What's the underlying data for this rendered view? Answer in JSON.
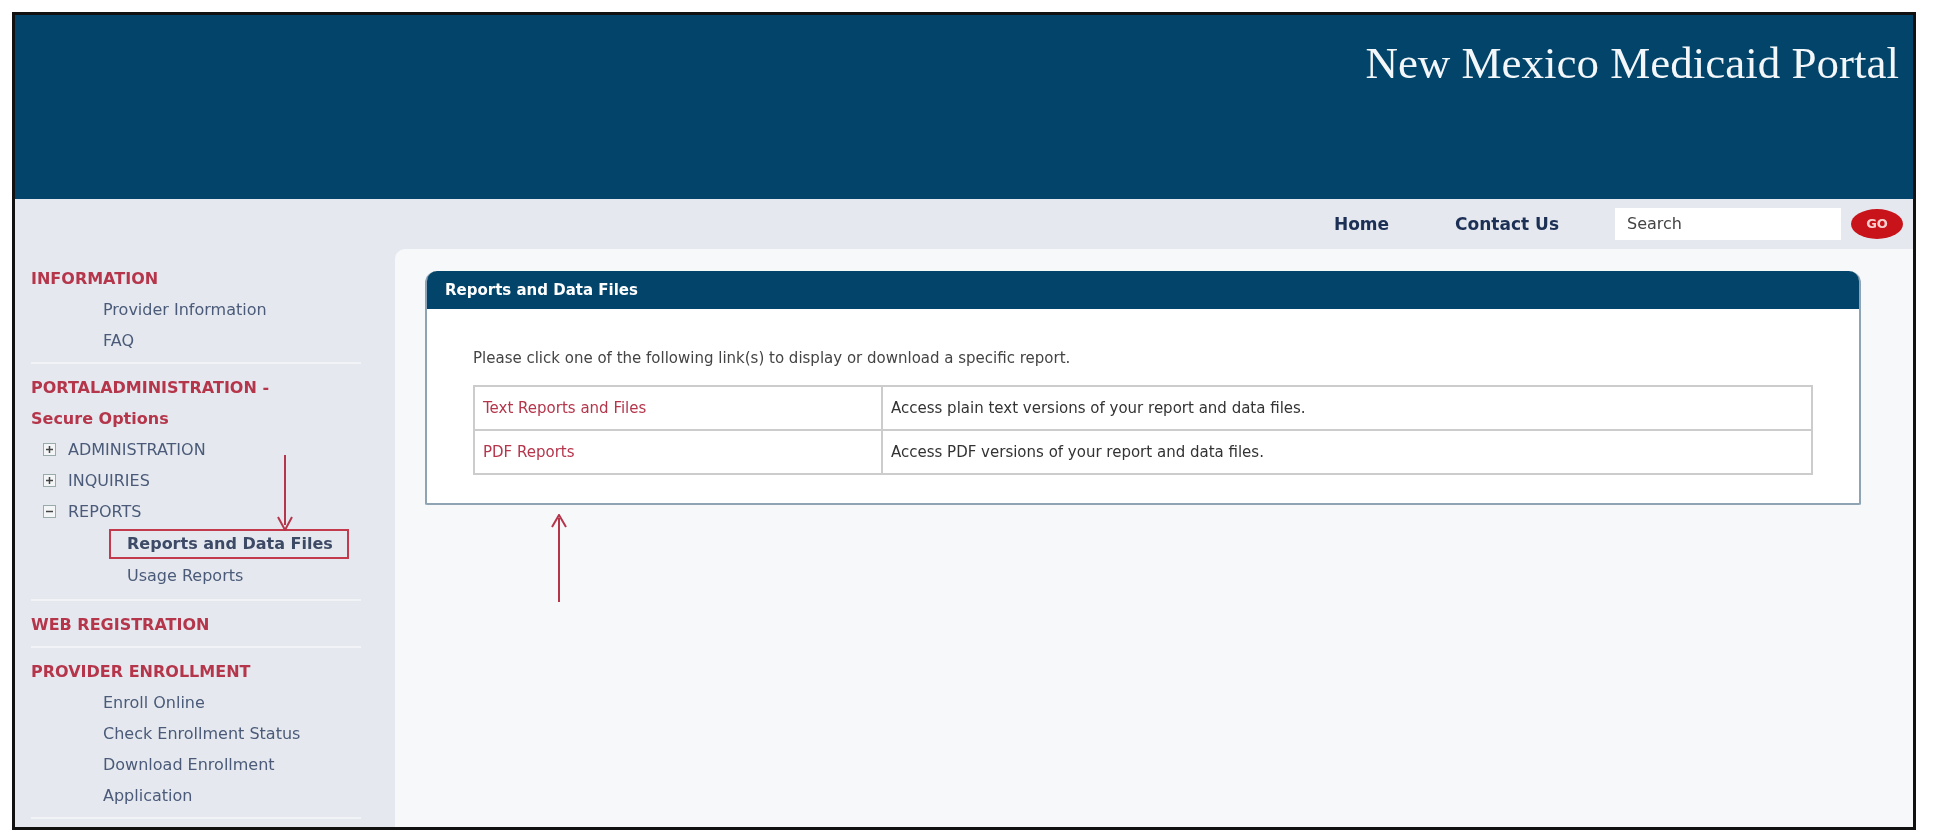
{
  "header": {
    "title": "New Mexico Medicaid Portal"
  },
  "nav": {
    "links": [
      "Home",
      "Contact Us"
    ],
    "search": {
      "placeholder": "Search"
    },
    "go_button": "GO"
  },
  "sidebar": {
    "sections": [
      {
        "heading": "INFORMATION",
        "items": [
          {
            "label": "Provider Information",
            "selected": false
          },
          {
            "label": "FAQ",
            "selected": false
          }
        ]
      },
      {
        "heading": "PORTALADMINISTRATION -",
        "subheading": "Secure Options",
        "tree": [
          {
            "label": "ADMINISTRATION",
            "expanded": false
          },
          {
            "label": "INQUIRIES",
            "expanded": false
          },
          {
            "label": "REPORTS",
            "expanded": true,
            "children": [
              {
                "label": "Reports and Data Files",
                "selected": true
              },
              {
                "label": "Usage Reports",
                "selected": false
              }
            ]
          }
        ]
      },
      {
        "heading": "WEB REGISTRATION"
      },
      {
        "heading": "PROVIDER ENROLLMENT",
        "items": [
          {
            "label": "Enroll Online",
            "selected": false
          },
          {
            "label": "Check Enrollment Status",
            "selected": false
          },
          {
            "label": "Download Enrollment Application",
            "selected": false
          }
        ]
      }
    ]
  },
  "panel": {
    "title": "Reports and Data Files",
    "intro": "Please click one of the following link(s) to display or download a specific report.",
    "rows": [
      {
        "link": "Text Reports and Files",
        "description": "Access plain text versions of your report and data files."
      },
      {
        "link": "PDF Reports",
        "description": "Access PDF versions of your report and data files."
      }
    ]
  }
}
